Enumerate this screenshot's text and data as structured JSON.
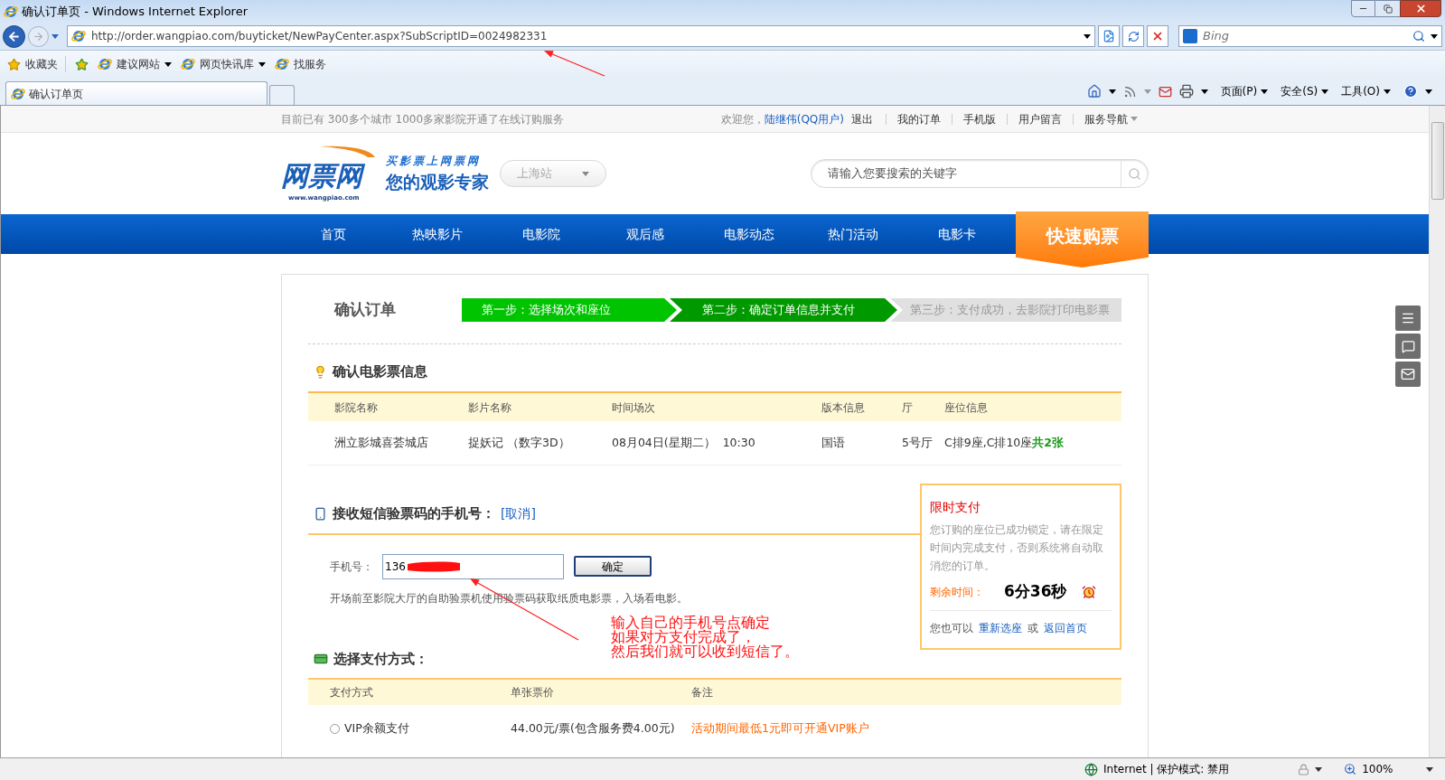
{
  "browser": {
    "title": "确认订单页 - Windows Internet Explorer",
    "address": {
      "url": "http://order.wangpiao.com/buyticket/NewPayCenter.aspx?SubScriptID=0024982331"
    },
    "search": {
      "placeholder": "Bing"
    },
    "favorites": [
      {
        "label": "收藏夹",
        "kind": "favorites"
      },
      {
        "label": "建议网站",
        "kind": "dropdown"
      },
      {
        "label": "网页快讯库",
        "kind": "dropdown"
      },
      {
        "label": "找服务",
        "kind": "link"
      }
    ],
    "tabs": [
      {
        "label": "确认订单页",
        "selected": true
      }
    ],
    "commands": [
      "页面(P)",
      "安全(S)",
      "工具(O)"
    ],
    "status_bar": {
      "zone": "Internet | 保护模式: 禁用",
      "zoom": "100%"
    }
  },
  "page": {
    "topbar": {
      "notice": "目前已有 300多个城市 1000多家影院开通了在线订购服务",
      "welcome": "欢迎您，",
      "user": "陆继伟(QQ用户)",
      "logout": "退出",
      "links": [
        {
          "label": "我的订单",
          "kind": "link"
        },
        {
          "label": "手机版",
          "kind": "link"
        },
        {
          "label": "用户留言",
          "kind": "link"
        },
        {
          "label": "服务导航",
          "kind": "menu"
        }
      ]
    },
    "header": {
      "logo": {
        "name": "网票网",
        "url": "www.wangpiao.com"
      },
      "slogan": [
        "买影票上网票网",
        "您的观影专家"
      ],
      "city": "上海站",
      "search": {
        "placeholder": "请输入您要搜索的关键字"
      }
    },
    "nav": {
      "items": [
        {
          "label": "首页",
          "selected": false
        },
        {
          "label": "热映影片",
          "selected": false
        },
        {
          "label": "电影院",
          "selected": false
        },
        {
          "label": "观后感",
          "selected": false
        },
        {
          "label": "电影动态",
          "selected": false
        },
        {
          "label": "热门活动",
          "selected": false
        },
        {
          "label": "电影卡",
          "selected": false
        }
      ],
      "quick_buy": "快速购票"
    },
    "order": {
      "title": "确认订单",
      "steps": [
        {
          "label": "第一步：选择场次和座位",
          "done": true,
          "selected": false
        },
        {
          "label": "第二步：确定订单信息并支付",
          "done": false,
          "selected": true
        },
        {
          "label": "第三步：支付成功，去影院打印电影票",
          "done": false,
          "selected": false
        }
      ],
      "ticket": {
        "heading": "确认电影票信息",
        "columns": [
          "影院名称",
          "影片名称",
          "时间场次",
          "版本信息",
          "厅",
          "座位信息"
        ],
        "row": {
          "cinema": "洲立影城喜荟城店",
          "film": "捉妖记 （数字3D）",
          "time": "08月04日(星期二）  10:30",
          "version": "国语",
          "hall": "5号厅",
          "seats": "C排9座,C排10座",
          "total": "共2张"
        }
      },
      "phone": {
        "heading": "接收短信验票码的手机号：",
        "cancel": "[取消]",
        "label": "手机号：",
        "value": "136",
        "submit": "确定",
        "note": "开场前至影院大厅的自助验票机使用验票码获取纸质电影票，入场看电影。"
      },
      "countdown": {
        "title": "限时支付",
        "message": "您订购的座位已成功锁定，请在限定时间内完成支付，否则系统将自动取消您的订单。",
        "remaining_label": "剩余时间：",
        "remaining": "6分36秒",
        "alternative": "您也可以",
        "rechoose": "重新选座",
        "or": "或",
        "home": "返回首页"
      },
      "payment": {
        "heading": "选择支付方式：",
        "columns": [
          "支付方式",
          "单张票价",
          "备注"
        ],
        "rows": [
          {
            "method": "VIP余额支付",
            "selected": false,
            "price": "44.00元/票(包含服务费4.00元)",
            "note": "活动期间最低1元即可开通VIP账户"
          }
        ]
      }
    }
  },
  "annotation": {
    "lines": [
      "输入自己的手机号点确定",
      "如果对方支付完成了，",
      "然后我们就可以收到短信了。"
    ]
  }
}
